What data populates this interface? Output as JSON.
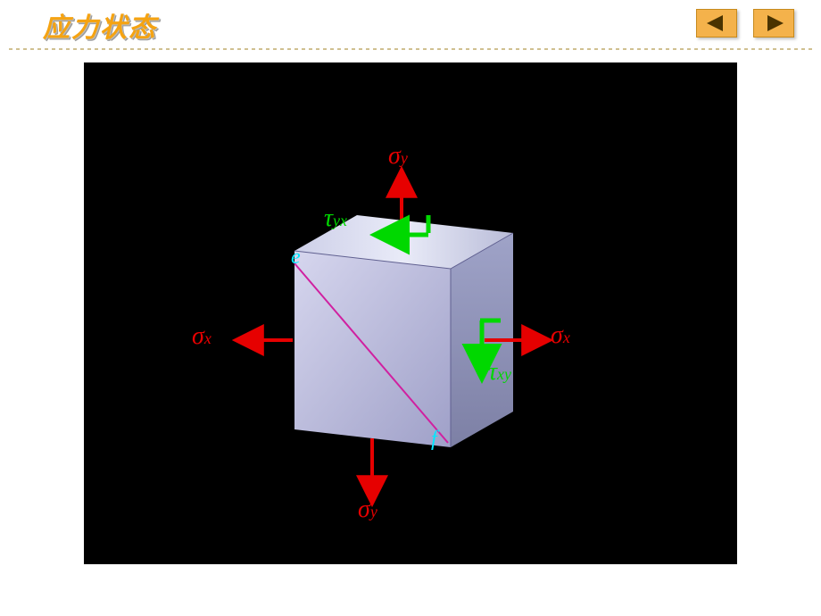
{
  "header": {
    "title": "应力状态"
  },
  "nav": {
    "prev_icon": "triangle-left",
    "next_icon": "triangle-right"
  },
  "labels": {
    "sigma_y_top": {
      "sym": "σ",
      "sub": "y"
    },
    "sigma_y_bot": {
      "sym": "σ",
      "sub": "y"
    },
    "sigma_x_left": {
      "sym": "σ",
      "sub": "x"
    },
    "sigma_x_right": {
      "sym": "σ",
      "sub": "x"
    },
    "tau_yx": {
      "sym": "τ",
      "sub": "yx"
    },
    "tau_xy": {
      "sym": "τ",
      "sub": "xy"
    },
    "point_e": "e",
    "point_f": "f"
  }
}
